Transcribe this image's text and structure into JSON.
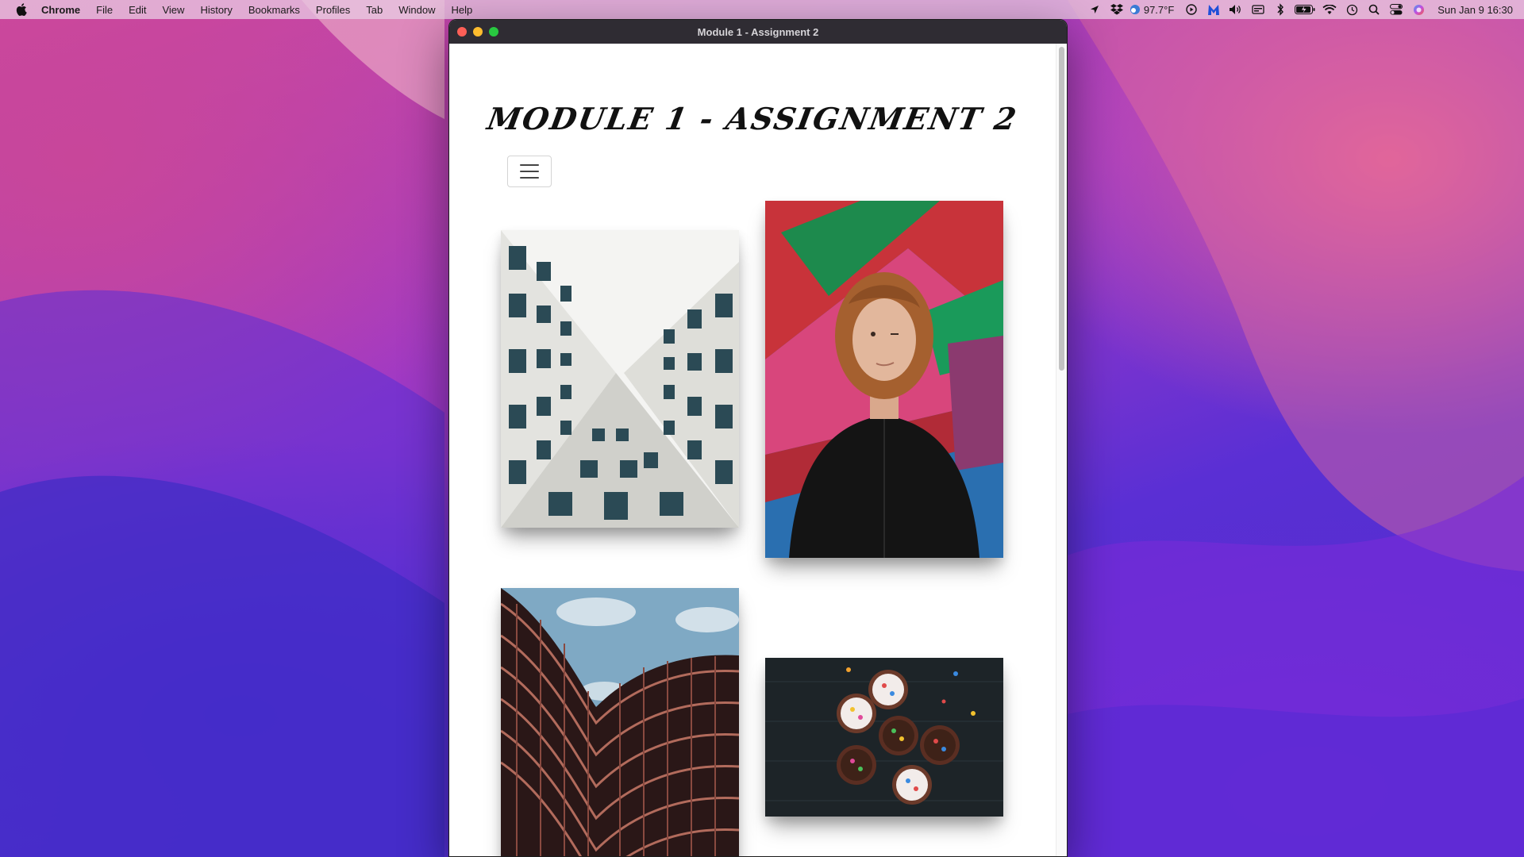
{
  "menubar": {
    "app_name": "Chrome",
    "items": [
      "File",
      "Edit",
      "View",
      "History",
      "Bookmarks",
      "Profiles",
      "Tab",
      "Window",
      "Help"
    ],
    "weather": "97.7°F",
    "clock": "Sun Jan 9  16:30"
  },
  "window": {
    "title": "Module 1 - Assignment 2"
  },
  "page": {
    "heading": "MODULE 1 - ASSIGNMENT 2",
    "menu_toggle_icon": "hamburger-icon",
    "photos": [
      {
        "subject": "building-upward-view-icon"
      },
      {
        "subject": "person-graffiti-wall-icon"
      },
      {
        "subject": "curved-building-icon"
      },
      {
        "subject": "cupcakes-icon"
      }
    ]
  },
  "colors": {
    "menubar_bg": "#e8c8e2",
    "titlebar_bg": "#2f2c33",
    "close": "#fe5f57",
    "minimize": "#febc2e",
    "zoom": "#28c840"
  }
}
